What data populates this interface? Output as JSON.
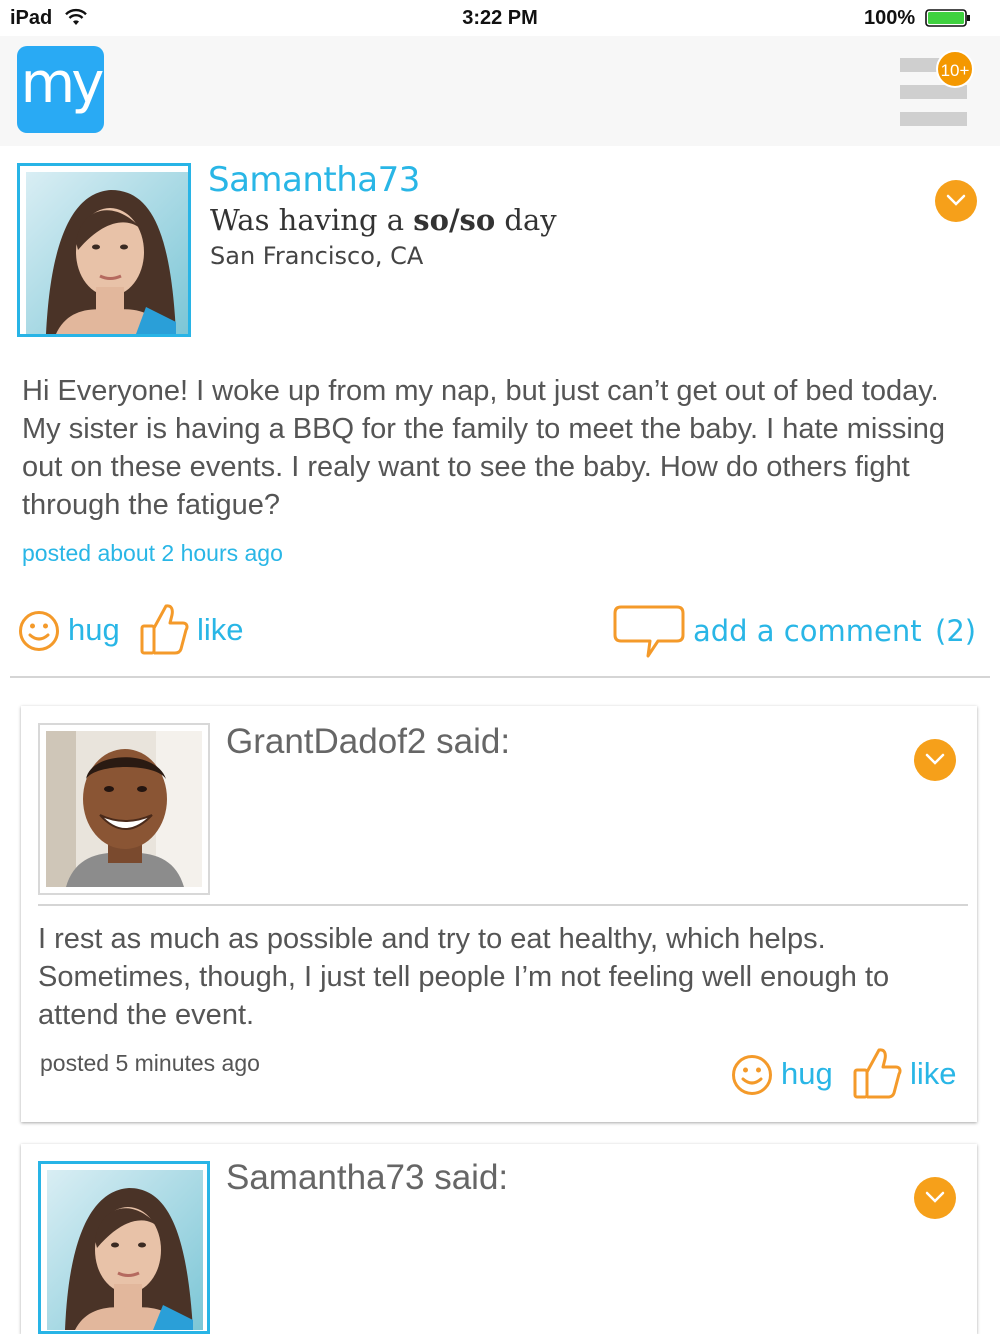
{
  "status_bar": {
    "device": "iPad",
    "time": "3:22 PM",
    "battery": "100%"
  },
  "header": {
    "logo_text": "my",
    "notification_count": "10+"
  },
  "post": {
    "username": "Samantha73",
    "mood_prefix": "Was having a ",
    "mood_value": "so/so",
    "mood_suffix": " day",
    "location": "San Francisco, CA",
    "body": "Hi Everyone! I woke up from my nap, but just can’t get out of bed today.  My sister is having a BBQ for the family to meet the baby. I hate missing out on these events.  I realy want to see the baby. How do others fight through the fatigue?",
    "posted": "posted about 2 hours ago",
    "hug_label": "hug",
    "like_label": "like",
    "comment_label": "add a comment",
    "comment_count": "(2)"
  },
  "comments": [
    {
      "said": "GrantDadof2 said:",
      "body": "I rest as much as possible and try to eat healthy, which helps. Sometimes, though, I just tell people I’m not feeling well enough to attend the event.",
      "posted": "posted 5 minutes ago",
      "hug_label": "hug",
      "like_label": "like"
    },
    {
      "said": "Samantha73 said:"
    }
  ],
  "colors": {
    "accent_blue": "#29b6e6",
    "accent_orange": "#f49800",
    "logo_blue": "#29aaf4"
  }
}
